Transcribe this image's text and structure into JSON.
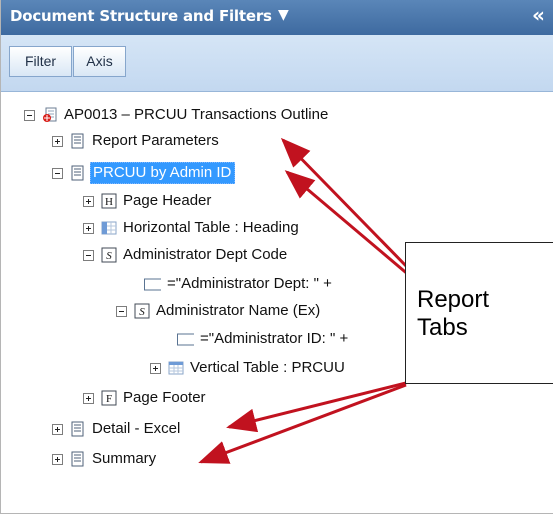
{
  "panel": {
    "title": "Document Structure and Filters",
    "title_caret": "▼",
    "collapse": "«"
  },
  "toolbar": {
    "filter_label": "Filter",
    "axis_label": "Axis"
  },
  "tree": {
    "root": "AP0013 – PRCUU Transactions Outline",
    "report_parameters": "Report Parameters",
    "prcuu_by_admin": "PRCUU by Admin ID",
    "page_header": "Page Header",
    "horizontal_table": "Horizontal Table : Heading",
    "admin_dept_code": "Administrator Dept Code",
    "admin_dept_formula": "=\"Administrator Dept: \" +",
    "admin_name": "Administrator Name (Ex)",
    "admin_id_formula": "=\"Administrator ID: \" +",
    "vertical_table": "Vertical Table : PRCUU",
    "page_footer": "Page Footer",
    "detail_excel": "Detail - Excel",
    "summary": "Summary"
  },
  "icons": {
    "document": "report-icon",
    "header": "H",
    "section": "S",
    "footer": "F",
    "cell": "cell-icon",
    "table": "table-icon"
  },
  "callout": {
    "text": "Report\nTabs"
  },
  "colors": {
    "header_blue": "#4a77ad",
    "toolbar_blue": "#cddff3",
    "selection_blue": "#3399ff",
    "arrow_red": "#c1121f"
  }
}
